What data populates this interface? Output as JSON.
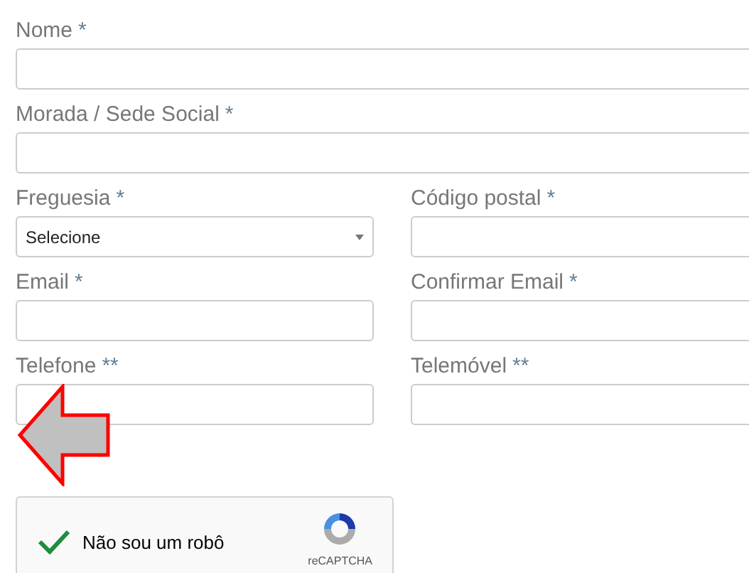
{
  "rows": [
    {
      "fields": [
        {
          "label": "Nome",
          "required_mark": "*",
          "kind": "text"
        }
      ]
    },
    {
      "fields": [
        {
          "label": "Morada / Sede Social",
          "required_mark": "*",
          "kind": "text"
        }
      ]
    },
    {
      "fields": [
        {
          "label": "Freguesia",
          "required_mark": "*",
          "kind": "select",
          "value": "Selecione"
        },
        {
          "label": "Código postal",
          "required_mark": "*",
          "kind": "text"
        }
      ]
    },
    {
      "fields": [
        {
          "label": "Email",
          "required_mark": "*",
          "kind": "text"
        },
        {
          "label": "Confirmar Email",
          "required_mark": "*",
          "kind": "text"
        }
      ]
    },
    {
      "fields": [
        {
          "label": "Telefone",
          "required_mark": "**",
          "kind": "text"
        },
        {
          "label": "Telemóvel",
          "required_mark": "**",
          "kind": "text"
        }
      ]
    }
  ],
  "recaptcha": {
    "label": "Não sou um robô",
    "checked": true,
    "brand": "reCAPTCHA"
  }
}
